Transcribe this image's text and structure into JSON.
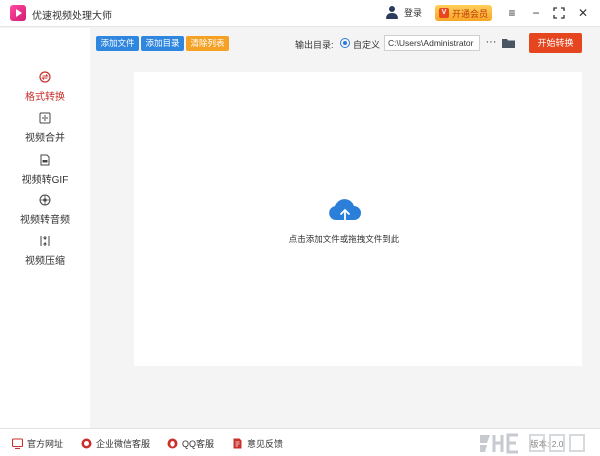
{
  "app": {
    "title": "优速视频处理大师"
  },
  "titlebar": {
    "login_label": "登录",
    "vip_label": "开通会员",
    "vip_icon": "V",
    "menu_glyph": "≡",
    "minimize_glyph": "−",
    "maximize_glyph": "⛶",
    "close_glyph": "✕"
  },
  "sidebar": {
    "items": [
      {
        "label": "格式转换",
        "icon": "format-convert-icon",
        "active": true
      },
      {
        "label": "视频合并",
        "icon": "video-merge-icon",
        "active": false
      },
      {
        "label": "视频转GIF",
        "icon": "video-to-gif-icon",
        "active": false
      },
      {
        "label": "视频转音频",
        "icon": "video-to-audio-icon",
        "active": false
      },
      {
        "label": "视频压缩",
        "icon": "video-compress-icon",
        "active": false
      }
    ]
  },
  "toolbar": {
    "add_file_label": "添加文件",
    "add_folder_label": "添加目录",
    "clear_list_label": "清除列表",
    "output_dir_label": "输出目录:",
    "custom_radio_label": "自定义",
    "output_path": "C:\\Users\\Administrator",
    "more_glyph": "···",
    "start_label": "开始转换"
  },
  "dropzone": {
    "hint": "点击添加文件或拖拽文件到此"
  },
  "footer": {
    "links": [
      {
        "label": "官方网址",
        "icon": "website-icon"
      },
      {
        "label": "企业微信客服",
        "icon": "wechat-service-icon"
      },
      {
        "label": "QQ客服",
        "icon": "qq-icon"
      },
      {
        "label": "意见反馈",
        "icon": "feedback-icon"
      }
    ],
    "version": "版本: 2.0"
  },
  "colors": {
    "accent_red": "#c9302c",
    "start_button": "#e5461f",
    "add_file_blue": "#2e86de",
    "clear_orange": "#f4a125",
    "cloud_blue": "#2b7fd8",
    "vip_gold": "#f8a526"
  }
}
